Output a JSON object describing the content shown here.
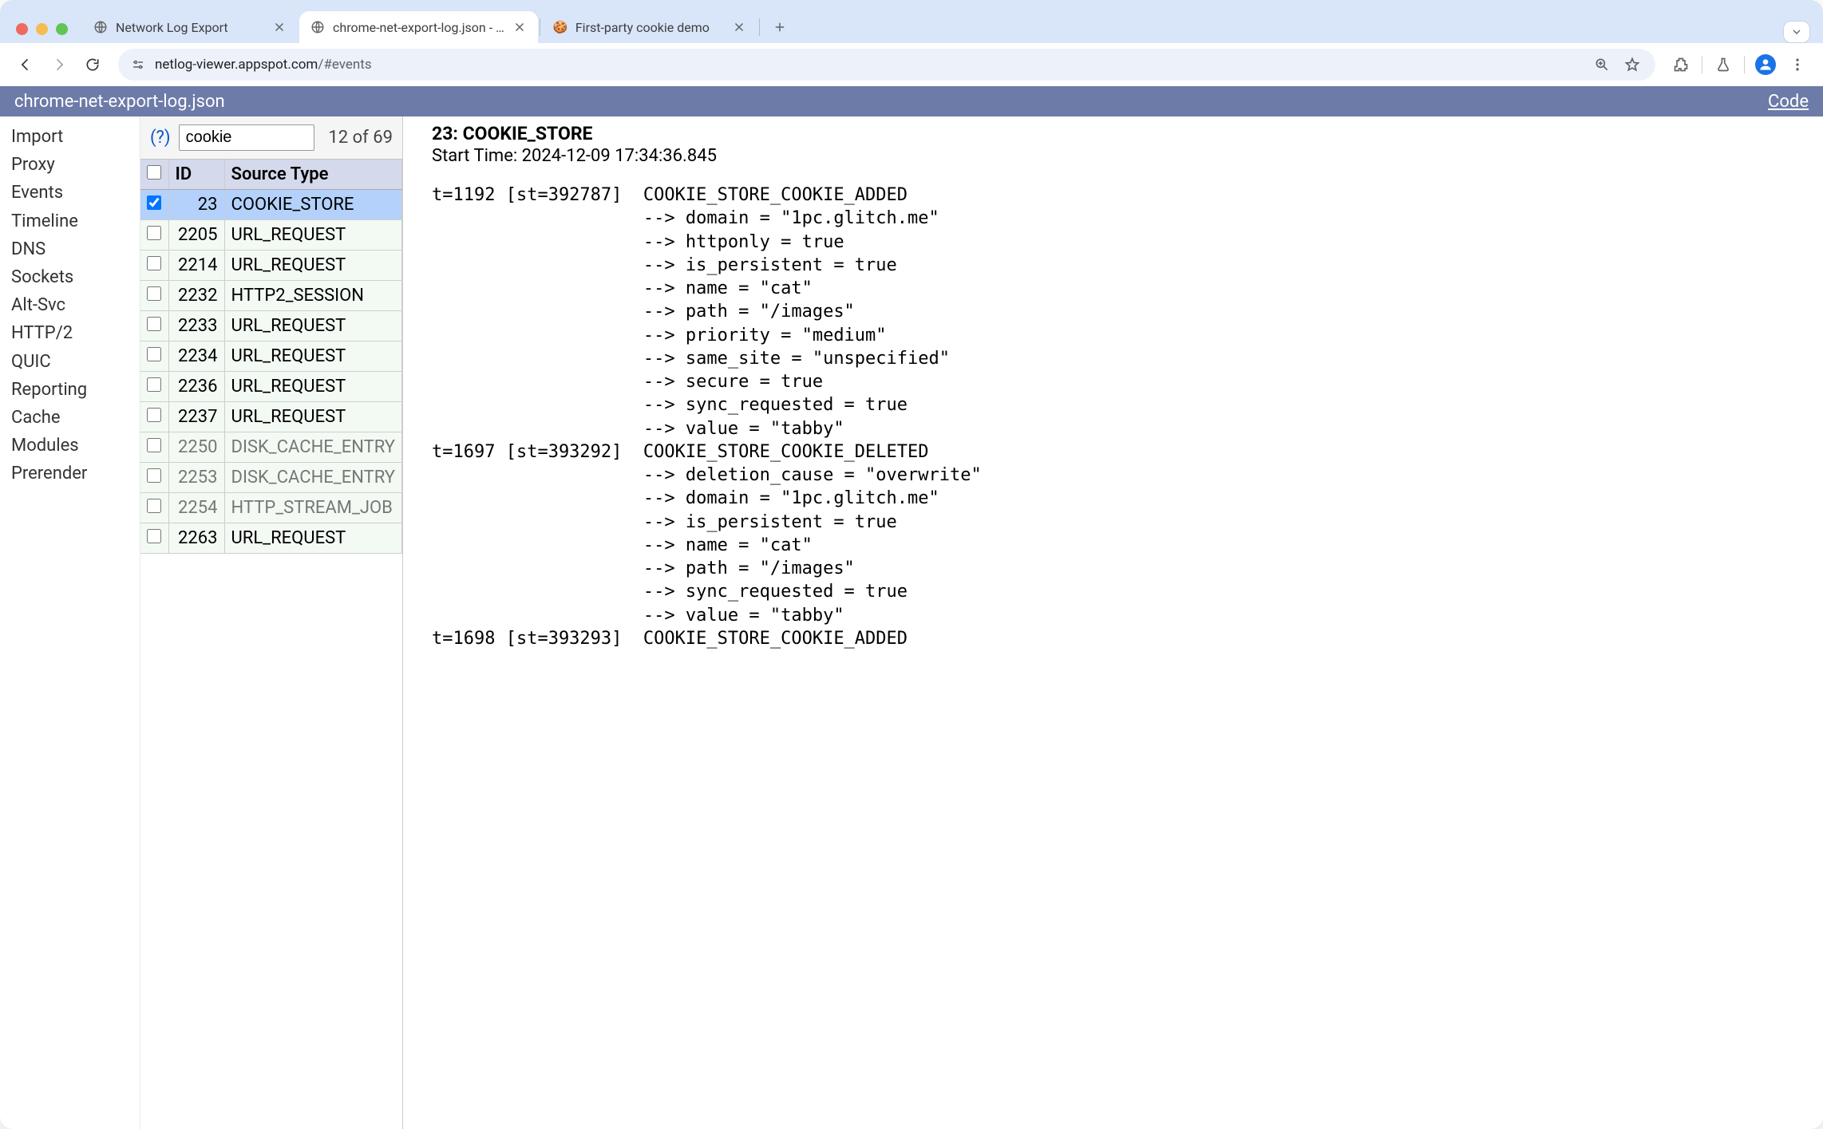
{
  "browser": {
    "tabs": [
      {
        "title": "Network Log Export",
        "favicon": "globe",
        "active": false,
        "closeable": true
      },
      {
        "title": "chrome-net-export-log.json - …",
        "favicon": "globe",
        "active": true,
        "closeable": true
      },
      {
        "title": "First-party cookie demo",
        "favicon": "cookie",
        "active": false,
        "closeable": true
      }
    ],
    "url_host": "netlog-viewer.appspot.com",
    "url_path": "/#events"
  },
  "app": {
    "filename": "chrome-net-export-log.json",
    "code_link": "Code",
    "nav": [
      "Import",
      "Proxy",
      "Events",
      "Timeline",
      "DNS",
      "Sockets",
      "Alt-Svc",
      "HTTP/2",
      "QUIC",
      "Reporting",
      "Cache",
      "Modules",
      "Prerender"
    ],
    "filter_help": "(?)",
    "filter_value": "cookie",
    "filter_count": "12 of 69",
    "columns": {
      "id": "ID",
      "type": "Source Type"
    },
    "rows": [
      {
        "id": "23",
        "type": "COOKIE_STORE",
        "selected": true,
        "dim": false
      },
      {
        "id": "2205",
        "type": "URL_REQUEST",
        "selected": false,
        "dim": false
      },
      {
        "id": "2214",
        "type": "URL_REQUEST",
        "selected": false,
        "dim": false
      },
      {
        "id": "2232",
        "type": "HTTP2_SESSION",
        "selected": false,
        "dim": false
      },
      {
        "id": "2233",
        "type": "URL_REQUEST",
        "selected": false,
        "dim": false
      },
      {
        "id": "2234",
        "type": "URL_REQUEST",
        "selected": false,
        "dim": false
      },
      {
        "id": "2236",
        "type": "URL_REQUEST",
        "selected": false,
        "dim": false
      },
      {
        "id": "2237",
        "type": "URL_REQUEST",
        "selected": false,
        "dim": false
      },
      {
        "id": "2250",
        "type": "DISK_CACHE_ENTRY",
        "selected": false,
        "dim": true
      },
      {
        "id": "2253",
        "type": "DISK_CACHE_ENTRY",
        "selected": false,
        "dim": true
      },
      {
        "id": "2254",
        "type": "HTTP_STREAM_JOB",
        "selected": false,
        "dim": true
      },
      {
        "id": "2263",
        "type": "URL_REQUEST",
        "selected": false,
        "dim": false
      }
    ]
  },
  "detail": {
    "title": "23: COOKIE_STORE",
    "start": "Start Time: 2024-12-09 17:34:36.845",
    "log": "t=1192 [st=392787]  COOKIE_STORE_COOKIE_ADDED\n                    --> domain = \"1pc.glitch.me\"\n                    --> httponly = true\n                    --> is_persistent = true\n                    --> name = \"cat\"\n                    --> path = \"/images\"\n                    --> priority = \"medium\"\n                    --> same_site = \"unspecified\"\n                    --> secure = true\n                    --> sync_requested = true\n                    --> value = \"tabby\"\nt=1697 [st=393292]  COOKIE_STORE_COOKIE_DELETED\n                    --> deletion_cause = \"overwrite\"\n                    --> domain = \"1pc.glitch.me\"\n                    --> is_persistent = true\n                    --> name = \"cat\"\n                    --> path = \"/images\"\n                    --> sync_requested = true\n                    --> value = \"tabby\"\nt=1698 [st=393293]  COOKIE_STORE_COOKIE_ADDED"
  }
}
